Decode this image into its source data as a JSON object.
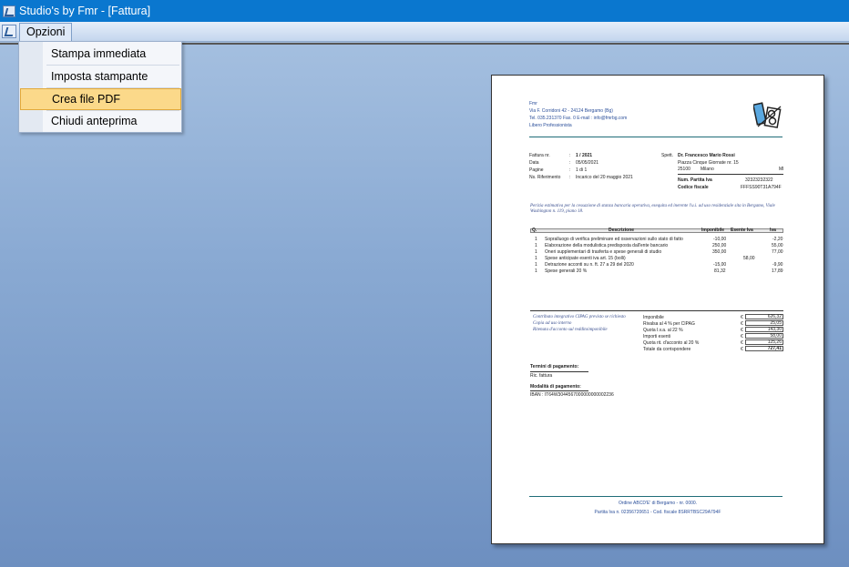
{
  "window": {
    "title": "Studio's by Fmr - [Fattura]"
  },
  "menu": {
    "opzioni_label": "Opzioni",
    "items": [
      {
        "label": "Stampa immediata"
      },
      {
        "label": "Imposta stampante"
      },
      {
        "label": "Crea file PDF"
      },
      {
        "label": "Chiudi anteprima"
      }
    ]
  },
  "invoice": {
    "header": {
      "name": "Fmr",
      "address": "Via F. Corridoni 42 - 24124 Bergamo (Bg)",
      "contacts": "Tel. 035.231370 Fax. 0 E-mail : info@fmrbg.com",
      "profession": "Libero Professionista"
    },
    "meta": {
      "fattura_label": "Fattura nr.",
      "fattura_value": "1 / 2021",
      "data_label": "Data",
      "data_value": "05/05/2021",
      "pagine_label": "Pagine",
      "pagine_value": "1 di 1",
      "rif_label": "Ns. Riferimento",
      "rif_value": "Incarico del 20 maggio 2021"
    },
    "recipient": {
      "spett": "Spett.",
      "name": "Dr. Francesco Mario Rossi",
      "street": "Piazza Cinque Giornate nr. 15",
      "cap": "25100",
      "city": "Milano",
      "prov": "MI",
      "piva_label": "Num. Partita Iva",
      "piva_value": "32323232322",
      "cf_label": "Codice fiscale",
      "cf_value": "FFFSS90T31A794F"
    },
    "description": "Perizia estimativa per la cessazione di stanza bancaria operativa, esequita ed inerente l'u.i. ad uso residenziale sita in Bergamo, Viale Washington n. 119, piano 18.",
    "table": {
      "headers": [
        "Q.",
        "Descrizione",
        "Imponibile",
        "Esente Iva",
        "Iva"
      ],
      "rows": [
        {
          "q": "1",
          "desc": "Sopralluogo di verifica preliminare ed osservazioni sullo stato di fatto",
          "imp": "-10,00",
          "es": "",
          "iva": "-2,20"
        },
        {
          "q": "1",
          "desc": "Elaborazione della modulistica predisposta dall'ente bancario",
          "imp": "250,00",
          "es": "",
          "iva": "55,00"
        },
        {
          "q": "1",
          "desc": "Oneri supplementari di trasferta e spese generali di studio",
          "imp": "350,00",
          "es": "",
          "iva": "77,00"
        },
        {
          "q": "1",
          "desc": "Spese anticipate esenti iva art. 15 (bolli)",
          "imp": "",
          "es": "58,00",
          "iva": ""
        },
        {
          "q": "1",
          "desc": "Detrazione acconti su n. ft. 27 a 29 del 2020",
          "imp": "-15,00",
          "es": "",
          "iva": "-9,90"
        },
        {
          "q": "1",
          "desc": "Spese generali 20 %",
          "imp": "81,32",
          "es": "",
          "iva": "17,89"
        }
      ]
    },
    "notes": [
      "Contributo integrativo CIPAG previsto se richiesto",
      "Copia ad uso interno",
      "Ritenuta d'acconto sul redditoimponibile"
    ],
    "totals": [
      {
        "label": "Imponibile",
        "cur": "€",
        "value": "626,32"
      },
      {
        "label": "Rivalsa al 4 % per CIPAG",
        "cur": "€",
        "value": "25,05"
      },
      {
        "label": "Quota I.v.a. al 22 %",
        "cur": "€",
        "value": "143,30"
      },
      {
        "label": "Importi esenti",
        "cur": "€",
        "value": "58,00"
      },
      {
        "label": "Quota rit. d'acconto al 20 %",
        "cur": "€",
        "value": "125,26"
      },
      {
        "label": "Totale da corrispondere",
        "cur": "€",
        "value": "727,41"
      }
    ],
    "payment": {
      "terms_label": "Termini di pagamento:",
      "terms_value": "Ric. fattura",
      "method_label": "Modalità di pagamento:",
      "method_value": "IBAN : IT64W3044567000000000002236"
    },
    "footer": {
      "line1": "Ordine ABCD'E' di Bergamo - nr. 0000.",
      "line2": "Partita Iva n. 02356720651 - Cod. fiscale 8SRRTBSC29A794F"
    }
  }
}
